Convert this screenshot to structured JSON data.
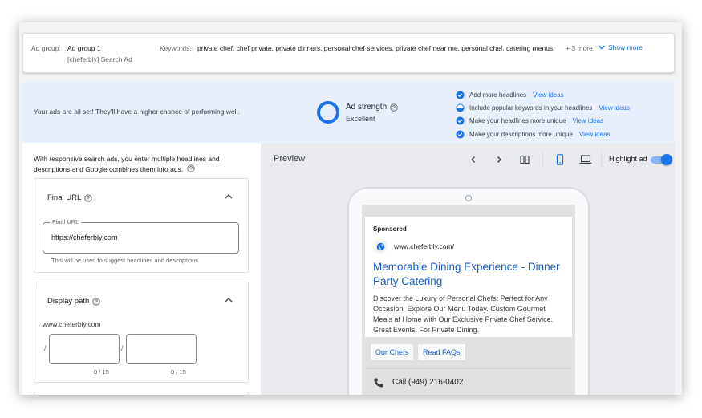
{
  "ad_group": {
    "label": "Ad group:",
    "name": "Ad group 1",
    "campaign": "[cheferbly] Search Ad"
  },
  "keywords": {
    "label": "Keywords:",
    "list": "private chef, chef private, private dinners, personal chef services, private chef near me, personal chef, catering menus",
    "more": "+ 3 more",
    "show_more": "Show more"
  },
  "banner": {
    "message": "Your ads are all set! They'll have a higher chance of performing well.",
    "strength_label": "Ad strength",
    "strength_value": "Excellent",
    "tips": [
      {
        "text": "Add more headlines",
        "link": "View ideas",
        "status": "complete"
      },
      {
        "text": "Include popular keywords in your headlines",
        "link": "View ideas",
        "status": "partial"
      },
      {
        "text": "Make your headlines more unique",
        "link": "View ideas",
        "status": "complete"
      },
      {
        "text": "Make your descriptions more unique",
        "link": "View ideas",
        "status": "complete"
      }
    ]
  },
  "left": {
    "intro": "With responsive search ads, you enter multiple headlines and descriptions and Google combines them into ads.",
    "final_url": {
      "title": "Final URL",
      "field_label": "Final URL",
      "value": "https://cheferbly.com",
      "helper": "This will be used to suggest headlines and descriptions"
    },
    "display_path": {
      "title": "Display path",
      "domain": "www.cheferbly.com",
      "path1_counter": "0 / 15",
      "path2_counter": "0 / 15"
    }
  },
  "preview": {
    "title": "Preview",
    "highlight_label": "Highlight ad",
    "highlight_on": true,
    "ad": {
      "sponsored": "Sponsored",
      "url": "www.cheferbly.com/",
      "headline": "Memorable Dining Experience - Dinner Party Catering",
      "description": "Discover the Luxury of Personal Chefs: Perfect for Any Occasion. Explore Our Menu Today. Custom Gourmet Meals at Home with Our Exclusive Private Chef Service. Great Events. For Private Dining.",
      "sitelinks": [
        "Our Chefs",
        "Read FAQs"
      ],
      "call": "Call (949) 216-0402"
    }
  },
  "colors": {
    "accent": "#1a73e8",
    "banner_bg": "#e8f0fe",
    "headline_link": "#1a5dc4"
  }
}
